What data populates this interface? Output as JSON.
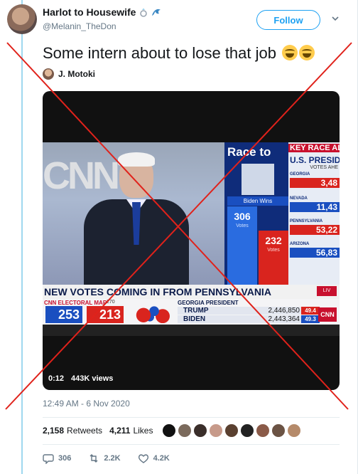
{
  "author": {
    "display_name": "Harlot to Housewife",
    "handle": "@Melanin_TheDon",
    "badges": [
      "ring-icon",
      "wave-icon"
    ]
  },
  "follow_button": {
    "label": "Follow"
  },
  "tweet": {
    "text": "Some intern about to lose that job",
    "emoji": [
      "tears-of-joy-emoji",
      "tears-of-joy-emoji"
    ]
  },
  "attribution": {
    "name": "J. Motoki"
  },
  "video": {
    "time": "0:12",
    "views": "443K views",
    "screen": {
      "race_title": "Race to",
      "key_title": "KEY RACE AL",
      "key_subtitle": "U.S. PRESID",
      "key_ahead": "VOTES AHE",
      "states": [
        {
          "name": "GEORGIA",
          "value": "3,48",
          "color": "#d9241e"
        },
        {
          "name": "NEVADA",
          "value": "11,43",
          "color": "#1a4fc0"
        },
        {
          "name": "PENNSYLVANIA",
          "value": "53,22",
          "color": "#d9241e"
        },
        {
          "name": "ARIZONA",
          "value": "56,83",
          "color": "#1a4fc0"
        }
      ],
      "biden_wins": "Biden Wins",
      "biden_votes": "306",
      "biden_votes_label": "Votes",
      "trump_votes": "232",
      "trump_votes_label": "Votes",
      "headline": "NEW VOTES COMING IN FROM PENNSYLVANIA",
      "live": "LIV",
      "ticker_title": "CNN ELECTORAL MAP",
      "ev_needed": "270",
      "ev_biden": "253",
      "ev_trump": "213",
      "ev_biden_label": "BIDEN",
      "ev_trump_label": "TRUMP",
      "ga_title": "GEORGIA PRESIDENT",
      "ga_rows": [
        {
          "name": "TRUMP",
          "votes": "2,446,850",
          "pct": "49.4",
          "color": "#d9241e"
        },
        {
          "name": "BIDEN",
          "votes": "2,443,364",
          "pct": "49.3",
          "color": "#1a4fc0"
        }
      ],
      "cnn_bug": "CNN"
    }
  },
  "timestamp": "12:49 AM - 6 Nov 2020",
  "stats": {
    "retweets_count": "2,158",
    "retweets_label": "Retweets",
    "likes_count": "4,211",
    "likes_label": "Likes"
  },
  "liker_colors": [
    "#111111",
    "#7b6a5c",
    "#3a2e2a",
    "#c79a8a",
    "#5a4030",
    "#222222",
    "#8a5a48",
    "#6b5344",
    "#b58a6a"
  ],
  "actions": {
    "replies": "306",
    "retweets": "2.2K",
    "likes": "4.2K"
  },
  "overlay": {
    "color": "#e0221b",
    "icon": "big-red-x"
  }
}
